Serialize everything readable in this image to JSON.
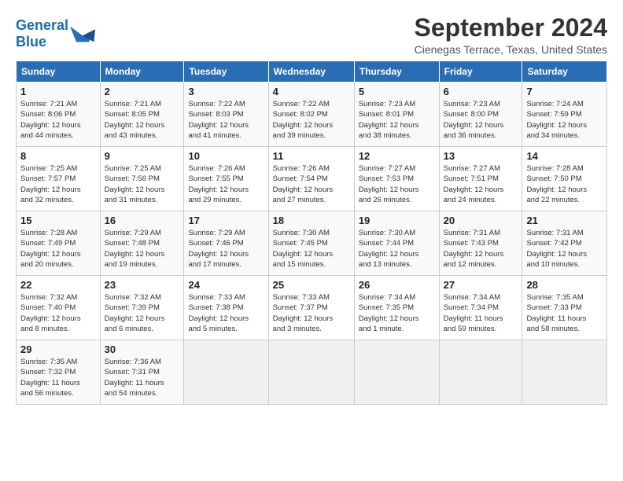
{
  "logo": {
    "line1": "General",
    "line2": "Blue"
  },
  "title": "September 2024",
  "subtitle": "Cienegas Terrace, Texas, United States",
  "days_header": [
    "Sunday",
    "Monday",
    "Tuesday",
    "Wednesday",
    "Thursday",
    "Friday",
    "Saturday"
  ],
  "weeks": [
    [
      {
        "day": "1",
        "info": "Sunrise: 7:21 AM\nSunset: 8:06 PM\nDaylight: 12 hours\nand 44 minutes."
      },
      {
        "day": "2",
        "info": "Sunrise: 7:21 AM\nSunset: 8:05 PM\nDaylight: 12 hours\nand 43 minutes."
      },
      {
        "day": "3",
        "info": "Sunrise: 7:22 AM\nSunset: 8:03 PM\nDaylight: 12 hours\nand 41 minutes."
      },
      {
        "day": "4",
        "info": "Sunrise: 7:22 AM\nSunset: 8:02 PM\nDaylight: 12 hours\nand 39 minutes."
      },
      {
        "day": "5",
        "info": "Sunrise: 7:23 AM\nSunset: 8:01 PM\nDaylight: 12 hours\nand 38 minutes."
      },
      {
        "day": "6",
        "info": "Sunrise: 7:23 AM\nSunset: 8:00 PM\nDaylight: 12 hours\nand 36 minutes."
      },
      {
        "day": "7",
        "info": "Sunrise: 7:24 AM\nSunset: 7:59 PM\nDaylight: 12 hours\nand 34 minutes."
      }
    ],
    [
      {
        "day": "8",
        "info": "Sunrise: 7:25 AM\nSunset: 7:57 PM\nDaylight: 12 hours\nand 32 minutes."
      },
      {
        "day": "9",
        "info": "Sunrise: 7:25 AM\nSunset: 7:56 PM\nDaylight: 12 hours\nand 31 minutes."
      },
      {
        "day": "10",
        "info": "Sunrise: 7:26 AM\nSunset: 7:55 PM\nDaylight: 12 hours\nand 29 minutes."
      },
      {
        "day": "11",
        "info": "Sunrise: 7:26 AM\nSunset: 7:54 PM\nDaylight: 12 hours\nand 27 minutes."
      },
      {
        "day": "12",
        "info": "Sunrise: 7:27 AM\nSunset: 7:53 PM\nDaylight: 12 hours\nand 26 minutes."
      },
      {
        "day": "13",
        "info": "Sunrise: 7:27 AM\nSunset: 7:51 PM\nDaylight: 12 hours\nand 24 minutes."
      },
      {
        "day": "14",
        "info": "Sunrise: 7:28 AM\nSunset: 7:50 PM\nDaylight: 12 hours\nand 22 minutes."
      }
    ],
    [
      {
        "day": "15",
        "info": "Sunrise: 7:28 AM\nSunset: 7:49 PM\nDaylight: 12 hours\nand 20 minutes."
      },
      {
        "day": "16",
        "info": "Sunrise: 7:29 AM\nSunset: 7:48 PM\nDaylight: 12 hours\nand 19 minutes."
      },
      {
        "day": "17",
        "info": "Sunrise: 7:29 AM\nSunset: 7:46 PM\nDaylight: 12 hours\nand 17 minutes."
      },
      {
        "day": "18",
        "info": "Sunrise: 7:30 AM\nSunset: 7:45 PM\nDaylight: 12 hours\nand 15 minutes."
      },
      {
        "day": "19",
        "info": "Sunrise: 7:30 AM\nSunset: 7:44 PM\nDaylight: 12 hours\nand 13 minutes."
      },
      {
        "day": "20",
        "info": "Sunrise: 7:31 AM\nSunset: 7:43 PM\nDaylight: 12 hours\nand 12 minutes."
      },
      {
        "day": "21",
        "info": "Sunrise: 7:31 AM\nSunset: 7:42 PM\nDaylight: 12 hours\nand 10 minutes."
      }
    ],
    [
      {
        "day": "22",
        "info": "Sunrise: 7:32 AM\nSunset: 7:40 PM\nDaylight: 12 hours\nand 8 minutes."
      },
      {
        "day": "23",
        "info": "Sunrise: 7:32 AM\nSunset: 7:39 PM\nDaylight: 12 hours\nand 6 minutes."
      },
      {
        "day": "24",
        "info": "Sunrise: 7:33 AM\nSunset: 7:38 PM\nDaylight: 12 hours\nand 5 minutes."
      },
      {
        "day": "25",
        "info": "Sunrise: 7:33 AM\nSunset: 7:37 PM\nDaylight: 12 hours\nand 3 minutes."
      },
      {
        "day": "26",
        "info": "Sunrise: 7:34 AM\nSunset: 7:35 PM\nDaylight: 12 hours\nand 1 minute."
      },
      {
        "day": "27",
        "info": "Sunrise: 7:34 AM\nSunset: 7:34 PM\nDaylight: 11 hours\nand 59 minutes."
      },
      {
        "day": "28",
        "info": "Sunrise: 7:35 AM\nSunset: 7:33 PM\nDaylight: 11 hours\nand 58 minutes."
      }
    ],
    [
      {
        "day": "29",
        "info": "Sunrise: 7:35 AM\nSunset: 7:32 PM\nDaylight: 11 hours\nand 56 minutes."
      },
      {
        "day": "30",
        "info": "Sunrise: 7:36 AM\nSunset: 7:31 PM\nDaylight: 11 hours\nand 54 minutes."
      },
      {
        "day": "",
        "info": ""
      },
      {
        "day": "",
        "info": ""
      },
      {
        "day": "",
        "info": ""
      },
      {
        "day": "",
        "info": ""
      },
      {
        "day": "",
        "info": ""
      }
    ]
  ]
}
